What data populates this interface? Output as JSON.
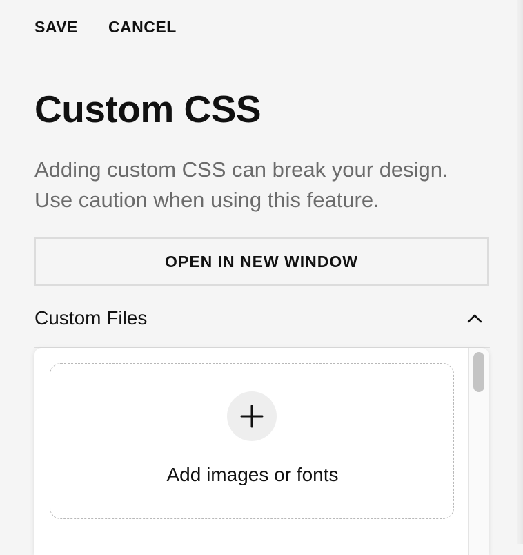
{
  "topbar": {
    "save_label": "SAVE",
    "cancel_label": "CANCEL"
  },
  "page": {
    "title": "Custom CSS",
    "description_line1": "Adding custom CSS can break your design.",
    "description_line2": "Use caution when using this feature."
  },
  "open_button": {
    "label": "OPEN IN NEW WINDOW"
  },
  "custom_files": {
    "section_label": "Custom Files",
    "expanded": true,
    "dropzone_label": "Add images or fonts",
    "add_icon": "plus-icon",
    "toggle_icon": "chevron-up-icon"
  },
  "colors": {
    "background": "#f5f5f5",
    "text": "#111111",
    "muted_text": "#6b6b6b",
    "card": "#ffffff"
  }
}
